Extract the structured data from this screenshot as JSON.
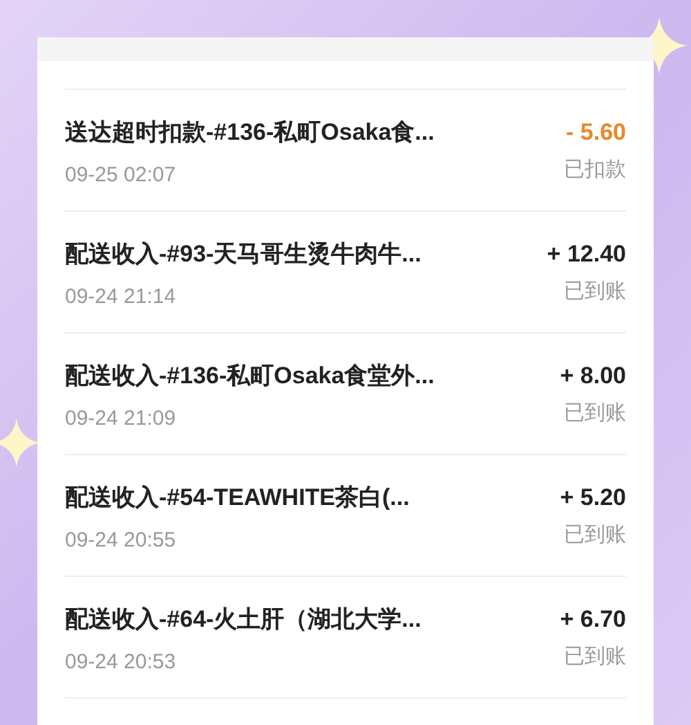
{
  "transactions": [
    {
      "title": "送达超时扣款-#136-私町Osaka食...",
      "time": "09-25 02:07",
      "amount": "- 5.60",
      "status": "已扣款",
      "kind": "deduction"
    },
    {
      "title": "配送收入-#93-天马哥生烫牛肉牛...",
      "time": "09-24 21:14",
      "amount": "+ 12.40",
      "status": "已到账",
      "kind": "income"
    },
    {
      "title": "配送收入-#136-私町Osaka食堂外...",
      "time": "09-24 21:09",
      "amount": "+ 8.00",
      "status": "已到账",
      "kind": "income"
    },
    {
      "title": "配送收入-#54-TEAWHITE茶白(...",
      "time": "09-24 20:55",
      "amount": "+ 5.20",
      "status": "已到账",
      "kind": "income"
    },
    {
      "title": "配送收入-#64-火土肝（湖北大学...",
      "time": "09-24 20:53",
      "amount": "+ 6.70",
      "status": "已到账",
      "kind": "income"
    }
  ]
}
